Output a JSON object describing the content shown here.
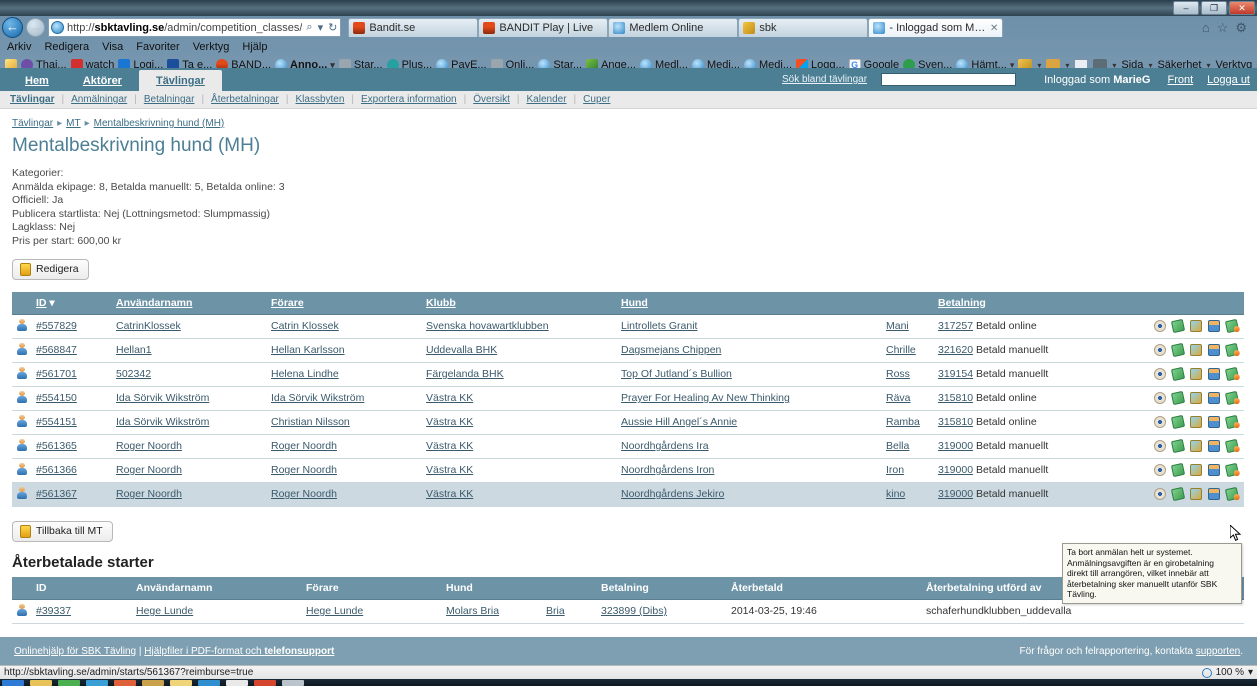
{
  "browser": {
    "window_buttons": [
      "–",
      "❐",
      "✕"
    ],
    "address_url_prefix": "http://",
    "address_url_host": "sbktavling.se",
    "address_url_path": "/admin/competition_classes/",
    "search_glyph": "⌕",
    "refresh_glyph": "↻",
    "tabs": [
      {
        "label": "Bandit.se",
        "favicon": "bandit-icon",
        "active": false
      },
      {
        "label": "BANDIT Play | Live",
        "favicon": "bandit-icon",
        "active": false
      },
      {
        "label": "Medlem Online",
        "favicon": "ie-icon",
        "active": false
      },
      {
        "label": "sbk",
        "favicon": "home-icon",
        "active": false
      },
      {
        "label": "- Inloggad som MarieG - SB...",
        "favicon": "ie-icon",
        "active": true
      }
    ],
    "tab_close_glyph": "✕",
    "chrome_icons": [
      "home-icon",
      "favorites-star-icon",
      "tools-gear-icon"
    ],
    "menus": [
      "Arkiv",
      "Redigera",
      "Visa",
      "Favoriter",
      "Verktyg",
      "Hjälp"
    ],
    "favorites": [
      {
        "label": "",
        "icon": "favorites-star-icon"
      },
      {
        "label": "Thai...",
        "icon": "purple-icon"
      },
      {
        "label": "watch",
        "icon": "youtube-icon"
      },
      {
        "label": "Logi...",
        "icon": "blue-k-icon"
      },
      {
        "label": "Ta e...",
        "icon": "paypal-icon"
      },
      {
        "label": "BAND...",
        "icon": "bandit-icon"
      },
      {
        "label": "Anno...",
        "icon": "ie-icon",
        "bold": true,
        "caret": "▾"
      },
      {
        "label": "Star...",
        "icon": "gray-icon"
      },
      {
        "label": "Plus...",
        "icon": "teal-icon"
      },
      {
        "label": "PayE...",
        "icon": "ie-icon"
      },
      {
        "label": "Onli...",
        "icon": "gray-icon"
      },
      {
        "label": "Star...",
        "icon": "ie-icon"
      },
      {
        "label": "Ange...",
        "icon": "house-icon"
      },
      {
        "label": "Medl...",
        "icon": "ie-icon"
      },
      {
        "label": "Medi...",
        "icon": "ie-icon"
      },
      {
        "label": "Medi...",
        "icon": "ie-icon"
      },
      {
        "label": "Logg...",
        "icon": "microsoft-icon"
      },
      {
        "label": "Google",
        "icon": "google-icon"
      },
      {
        "label": "Sven...",
        "icon": "green-icon"
      },
      {
        "label": "Hämt...",
        "icon": "ie-icon",
        "caret": "▾"
      }
    ],
    "command_bar": [
      "Sida",
      "Säkerhet",
      "Verktyg"
    ],
    "command_caret": "▾"
  },
  "app": {
    "main_tabs": [
      {
        "label": "Hem",
        "selected": false
      },
      {
        "label": "Aktörer",
        "selected": false
      },
      {
        "label": "Tävlingar",
        "selected": true
      }
    ],
    "search_label": "Sök bland tävlingar",
    "search_value": "",
    "logged_in_prefix": "Inloggad som ",
    "logged_in_user": "MarieG",
    "front_link": "Front",
    "logout_link": "Logga ut",
    "subnav": [
      "Tävlingar",
      "Anmälningar",
      "Betalningar",
      "Återbetalningar",
      "Klassbyten",
      "Exportera information",
      "Översikt",
      "Kalender",
      "Cuper"
    ],
    "breadcrumb": [
      "Tävlingar",
      "MT",
      "Mentalbeskrivning hund (MH)"
    ],
    "breadcrumb_arrow": "▸",
    "page_title": "Mentalbeskrivning hund (MH)",
    "meta_lines": [
      "Kategorier:",
      "Anmälda ekipage: 8, Betalda manuellt: 5, Betalda online: 3",
      "Officiell: Ja",
      "Publicera startlista: Nej (Lottningsmetod: Slumpmassig)",
      "Lagklass: Nej",
      "Pris per start: 600,00 kr"
    ],
    "edit_button": "Redigera",
    "back_button": "Tillbaka till MT"
  },
  "starts_table": {
    "headers": [
      "ID",
      "Användarnamn",
      "Förare",
      "Klubb",
      "Hund",
      "Betalning"
    ],
    "sort_glyph": "▾",
    "rows": [
      {
        "id": "#557829",
        "username": "CatrinKlossek",
        "driver": "Catrin Klossek",
        "club": "Svenska hovawartklubben",
        "dog": "Lintrollets Granit",
        "callname": "Mani",
        "payment_id": "317257",
        "payment_status": "Betald online",
        "hover": false
      },
      {
        "id": "#568847",
        "username": "Hellan1",
        "driver": "Hellan Karlsson",
        "club": "Uddevalla BHK",
        "dog": "Dagsmejans Chippen",
        "callname": "Chrille",
        "payment_id": "321620",
        "payment_status": "Betald manuellt",
        "hover": false
      },
      {
        "id": "#561701",
        "username": "502342",
        "driver": "Helena Lindhe",
        "club": "Färgelanda BHK",
        "dog": "Top Of Jutland´s Bullion",
        "callname": "Ross",
        "payment_id": "319154",
        "payment_status": "Betald manuellt",
        "hover": false
      },
      {
        "id": "#554150",
        "username": "Ida Sörvik Wikström",
        "driver": "Ida Sörvik Wikström",
        "club": "Västra KK",
        "dog": "Prayer For Healing Av New Thinking",
        "callname": "Räva",
        "payment_id": "315810",
        "payment_status": "Betald online",
        "hover": false
      },
      {
        "id": "#554151",
        "username": "Ida Sörvik Wikström",
        "driver": "Christian Nilsson",
        "club": "Västra KK",
        "dog": "Aussie Hill Angel´s Annie",
        "callname": "Ramba",
        "payment_id": "315810",
        "payment_status": "Betald online",
        "hover": false
      },
      {
        "id": "#561365",
        "username": "Roger Noordh",
        "driver": "Roger Noordh",
        "club": "Västra KK",
        "dog": "Noordhgårdens Ira",
        "callname": "Bella",
        "payment_id": "319000",
        "payment_status": "Betald manuellt",
        "hover": false
      },
      {
        "id": "#561366",
        "username": "Roger Noordh",
        "driver": "Roger Noordh",
        "club": "Västra KK",
        "dog": "Noordhgårdens Iron",
        "callname": "Iron",
        "payment_id": "319000",
        "payment_status": "Betald manuellt",
        "hover": false
      },
      {
        "id": "#561367",
        "username": "Roger Noordh",
        "driver": "Roger Noordh",
        "club": "Västra KK",
        "dog": "Noordhgårdens Jekiro",
        "callname": "kino",
        "payment_id": "319000",
        "payment_status": "Betald manuellt",
        "hover": true
      }
    ],
    "action_icons": [
      "view-eye-icon",
      "payment-money-icon",
      "pay-user-money-icon",
      "edit-user-icon",
      "refund-money-icon"
    ]
  },
  "tooltip": {
    "text": "Ta bort anmälan helt ur systemet. Anmälningsavgiften är en girobetalning direkt till arrangören, vilket innebär att återbetalning sker manuellt utanför SBK Tävling."
  },
  "refunds_section": {
    "title": "Återbetalade starter",
    "headers": [
      "ID",
      "Användarnamn",
      "Förare",
      "Hund",
      "Betalning",
      "Återbetald",
      "Återbetalning utförd av"
    ],
    "rows": [
      {
        "id": "#39337",
        "username": "Hege Lunde",
        "driver": "Hege Lunde",
        "dog": "Molars Bria",
        "callname": "Bria",
        "payment": "323899 (Dibs)",
        "refunded": "2014-03-25, 19:46",
        "refunded_by": "schaferhundklubben_uddevalla"
      }
    ]
  },
  "footer": {
    "help_link": "Onlinehjälp för SBK Tävling",
    "separator": "|",
    "pdf_link_prefix": "Hjälpfiler i PDF-format och ",
    "pdf_link_bold": "telefonsupport",
    "right_text": "För frågor och felrapportering, kontakta ",
    "right_link": "supporten",
    "right_period": "."
  },
  "statusbar": {
    "url": "http://sbktavling.se/admin/starts/561367?reimburse=true",
    "zoom": "100 %",
    "zoom_caret": "▾"
  }
}
